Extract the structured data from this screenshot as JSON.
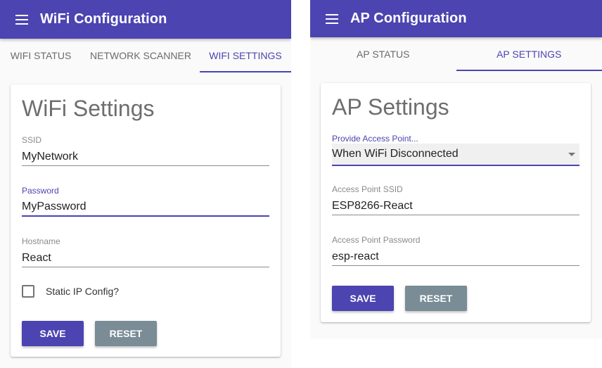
{
  "wifi_panel": {
    "app_title": "WiFi Configuration",
    "tabs": [
      {
        "label": "WIFI STATUS",
        "active": false
      },
      {
        "label": "NETWORK SCANNER",
        "active": false
      },
      {
        "label": "WIFI SETTINGS",
        "active": true
      }
    ],
    "card_title": "WiFi Settings",
    "fields": {
      "ssid": {
        "label": "SSID",
        "value": "MyNetwork"
      },
      "password": {
        "label": "Password",
        "value": "MyPassword"
      },
      "hostname": {
        "label": "Hostname",
        "value": "React"
      }
    },
    "static_ip": {
      "label": "Static IP Config?",
      "checked": false
    },
    "save_label": "SAVE",
    "reset_label": "RESET"
  },
  "ap_panel": {
    "app_title": "AP Configuration",
    "tabs": [
      {
        "label": "AP STATUS",
        "active": false
      },
      {
        "label": "AP SETTINGS",
        "active": true
      }
    ],
    "card_title": "AP Settings",
    "provision_mode": {
      "label": "Provide Access Point...",
      "selected": "When WiFi Disconnected"
    },
    "fields": {
      "ap_ssid": {
        "label": "Access Point SSID",
        "value": "ESP8266-React"
      },
      "ap_password": {
        "label": "Access Point Password",
        "value": "esp-react"
      }
    },
    "save_label": "SAVE",
    "reset_label": "RESET"
  },
  "colors": {
    "primary": "#4c44b1",
    "secondary_button": "#7a8c96",
    "background": "#fafafa"
  }
}
